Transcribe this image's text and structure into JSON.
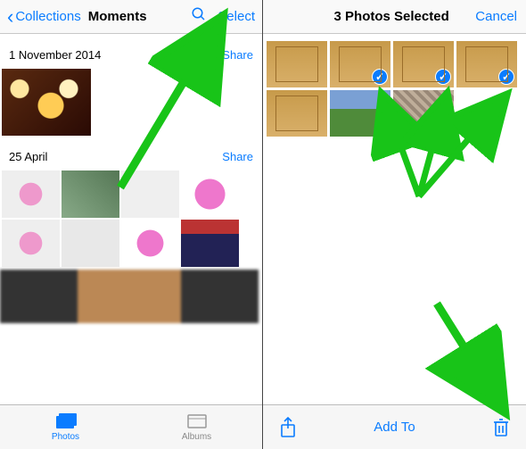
{
  "left": {
    "nav": {
      "back_label": "Collections",
      "title": "Moments",
      "search_icon": "search",
      "select_label": "Select"
    },
    "sections": [
      {
        "date": "1 November 2014",
        "share": "Share",
        "thumbs": 1
      },
      {
        "date": "25 April",
        "share": "Share",
        "thumbs": 8
      }
    ],
    "tabs": {
      "photos": "Photos",
      "albums": "Albums"
    }
  },
  "right": {
    "nav": {
      "title": "3 Photos Selected",
      "cancel": "Cancel"
    },
    "grid": {
      "row1": [
        {
          "selected": false,
          "kind": "court"
        },
        {
          "selected": true,
          "kind": "court"
        },
        {
          "selected": true,
          "kind": "court"
        },
        {
          "selected": true,
          "kind": "court"
        }
      ],
      "row2": [
        {
          "selected": false,
          "kind": "court"
        },
        {
          "selected": false,
          "kind": "golf"
        },
        {
          "selected": false,
          "kind": "crowd"
        }
      ]
    },
    "toolbar": {
      "share_icon": "share",
      "addto": "Add To",
      "trash_icon": "trash"
    }
  },
  "annotations": {
    "arrow_to_select": true,
    "arrows_to_selected_thumbs": 3,
    "arrow_to_trash": true
  }
}
